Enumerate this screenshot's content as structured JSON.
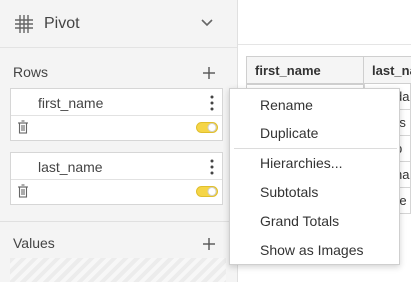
{
  "sidebar": {
    "pivot_title": "Pivot",
    "rows": {
      "title": "Rows",
      "fields": [
        {
          "name": "first_name",
          "toggle_on": true
        },
        {
          "name": "last_name",
          "toggle_on": true
        }
      ]
    },
    "values": {
      "title": "Values"
    }
  },
  "table": {
    "headers": [
      "first_name",
      "last_na"
    ],
    "partial_cells": [
      "da",
      "rs",
      "p",
      "ha",
      "re"
    ]
  },
  "context_menu": {
    "items": [
      "Rename",
      "Duplicate",
      "Hierarchies...",
      "Subtotals",
      "Grand Totals",
      "Show as Images"
    ]
  },
  "colors": {
    "toggle_accent": "#f5d547",
    "sidebar_bg": "#f4f4f4"
  },
  "icons": [
    "grid-icon",
    "chevron-down-icon",
    "plus-icon",
    "kebab-icon",
    "trash-icon",
    "toggle-icon"
  ]
}
